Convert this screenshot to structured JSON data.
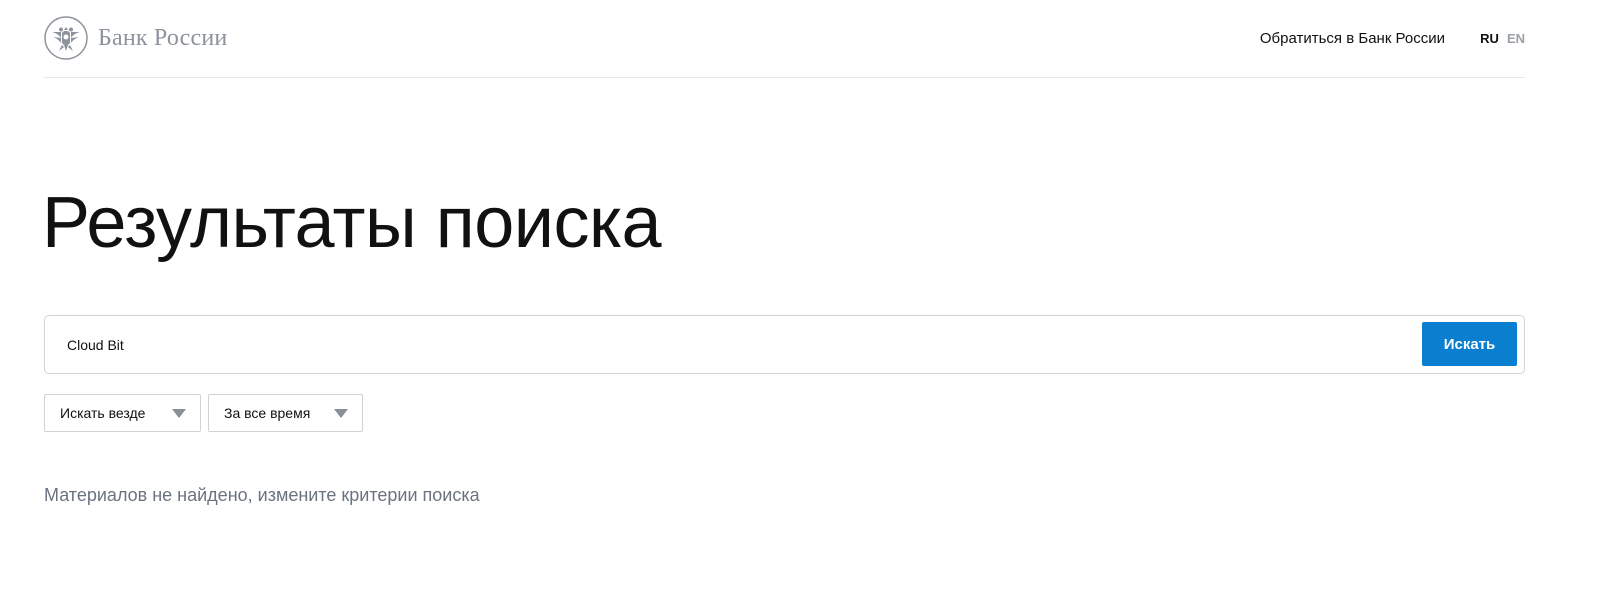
{
  "header": {
    "logo_text": "Банк России",
    "contact_link": "Обратиться в Банк России",
    "lang_active": "RU",
    "lang_other": "EN"
  },
  "main": {
    "title": "Результаты поиска",
    "search": {
      "value": "Cloud Bit",
      "button_label": "Искать"
    },
    "filters": {
      "scope": "Искать везде",
      "period": "За все время"
    },
    "empty_message": "Материалов не найдено, измените критерии поиска"
  },
  "colors": {
    "accent": "#0b7fcf",
    "muted_text": "#6b7380",
    "logo_gray": "#8d939c"
  },
  "icons": {
    "logo": "double-headed-eagle-icon",
    "dropdown": "chevron-down-icon"
  }
}
